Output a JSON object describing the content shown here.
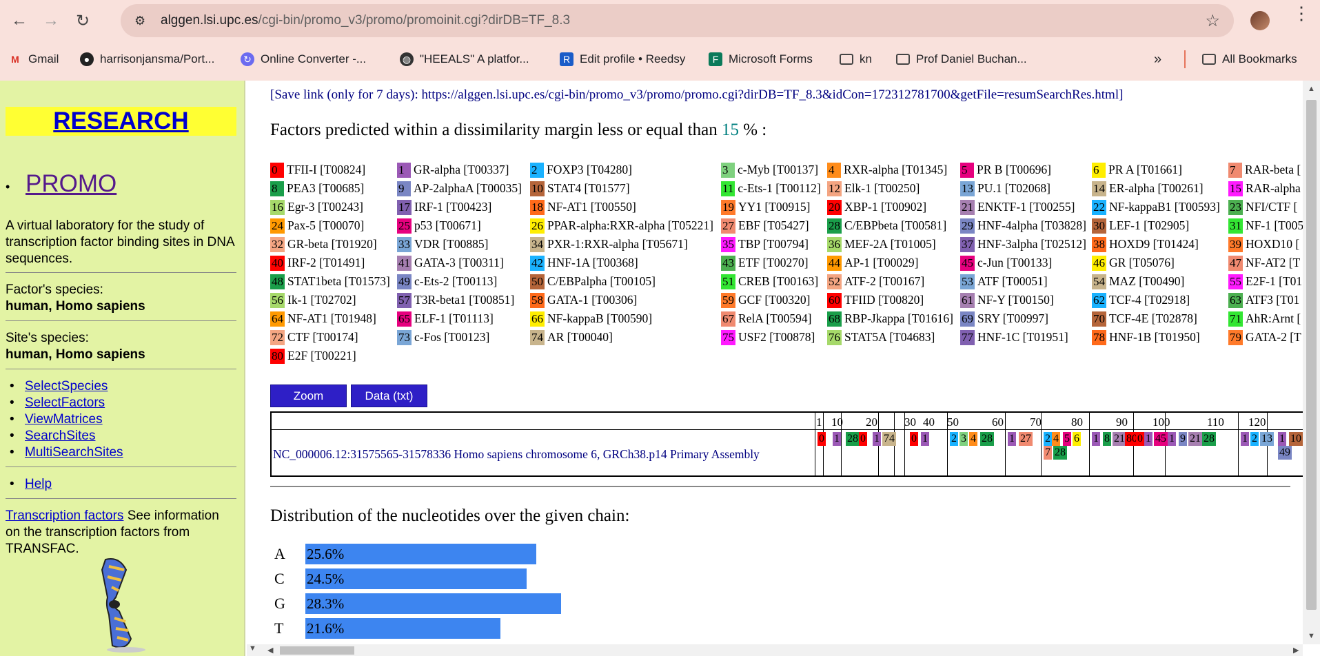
{
  "browser": {
    "url_host": "alggen.lsi.upc.es",
    "url_path": "/cgi-bin/promo_v3/promo/promoinit.cgi?dirDB=TF_8.3",
    "bookmarks": [
      "Gmail",
      "harrisonjansma/Port...",
      "Online Converter -...",
      "\"HEEALS\" A platfor...",
      "Edit profile • Reedsy",
      "Microsoft Forms",
      "kn",
      "Prof Daniel Buchan...",
      "All Bookmarks"
    ]
  },
  "sidebar": {
    "research": "RESEARCH",
    "promo": "PROMO",
    "description": "A virtual laboratory for the study of transcription factor binding sites in DNA sequences.",
    "factor_species_label": "Factor's species:",
    "factor_species": "human, Homo sapiens",
    "site_species_label": "Site's species:",
    "site_species": "human, Homo sapiens",
    "links": [
      "SelectSpecies",
      "SelectFactors",
      "ViewMatrices",
      "SearchSites",
      "MultiSearchSites"
    ],
    "help": "Help",
    "tf_link": "Transcription factors",
    "tf_text": " See information on the transcription factors from TRANSFAC."
  },
  "main": {
    "save_link": "[Save link (only for 7 days): https://alggen.lsi.upc.es/cgi-bin/promo_v3/promo/promo.cgi?dirDB=TF_8.3&idCon=172312781700&getFile=resumSearchRes.html]",
    "factors_title": "Factors predicted within a dissimilarity margin less or equal than ",
    "margin": "15",
    "margin_suffix": " % :",
    "zoom_label": "Zoom",
    "data_label": "Data (txt)",
    "sequence_name": "NC_000006.12:31575565-31578336 Homo sapiens chromosome 6, GRCh38.p14 Primary Assembly",
    "ticks": [
      "1",
      "10",
      "20",
      "30",
      "40",
      "50",
      "60",
      "70",
      "80",
      "90",
      "100",
      "110",
      "120"
    ],
    "dist_title": "Distribution of the nucleotides over the given chain:",
    "nucleotides": [
      {
        "base": "A",
        "label": "25.6%",
        "value": 25.6
      },
      {
        "base": "C",
        "label": "24.5%",
        "value": 24.5
      },
      {
        "base": "G",
        "label": "28.3%",
        "value": 28.3
      },
      {
        "base": "T",
        "label": "21.6%",
        "value": 21.6
      }
    ]
  },
  "factors": [
    [
      "0",
      "TFII-I [T00824]",
      "#ff0000"
    ],
    [
      "1",
      "GR-alpha [T00337]",
      "#9b59b6"
    ],
    [
      "2",
      "FOXP3 [T04280]",
      "#1ab2ff"
    ],
    [
      "3",
      "c-Myb [T00137]",
      "#7fd17f"
    ],
    [
      "4",
      "RXR-alpha [T01345]",
      "#ff8c1a"
    ],
    [
      "5",
      "PR B [T00696]",
      "#e6007e"
    ],
    [
      "6",
      "PR A [T01661]",
      "#ffee00"
    ],
    [
      "7",
      "RAR-beta [",
      "#f08a70"
    ],
    [
      "8",
      "PEA3 [T00685]",
      "#1a9e4a"
    ],
    [
      "9",
      "AP-2alphaA [T00035]",
      "#7a86c4"
    ],
    [
      "10",
      "STAT4 [T01577]",
      "#b5653a"
    ],
    [
      "11",
      "c-Ets-1 [T00112]",
      "#33e633"
    ],
    [
      "12",
      "Elk-1 [T00250]",
      "#f4a582"
    ],
    [
      "13",
      "PU.1 [T02068]",
      "#7aa6d6"
    ],
    [
      "14",
      "ER-alpha [T00261]",
      "#c8b48c"
    ],
    [
      "15",
      "RAR-alpha",
      "#ff1aff"
    ],
    [
      "16",
      "Egr-3 [T00243]",
      "#a6d96a"
    ],
    [
      "17",
      "IRF-1 [T00423]",
      "#8060b0"
    ],
    [
      "18",
      "NF-AT1 [T00550]",
      "#ff6a1a"
    ],
    [
      "19",
      "YY1 [T00915]",
      "#ff7a2a"
    ],
    [
      "20",
      "XBP-1 [T00902]",
      "#ff0000"
    ],
    [
      "21",
      "ENKTF-1 [T00255]",
      "#a67fb0"
    ],
    [
      "22",
      "NF-kappaB1 [T00593]",
      "#1ab2ff"
    ],
    [
      "23",
      "NFI/CTF [",
      "#4caf50"
    ],
    [
      "24",
      "Pax-5 [T00070]",
      "#ff9900"
    ],
    [
      "25",
      "p53 [T00671]",
      "#e6007e"
    ],
    [
      "26",
      "PPAR-alpha:RXR-alpha [T05221]",
      "#ffee00"
    ],
    [
      "27",
      "EBF [T05427]",
      "#f08a70"
    ],
    [
      "28",
      "C/EBPbeta [T00581]",
      "#1a9e4a"
    ],
    [
      "29",
      "HNF-4alpha [T03828]",
      "#7a86c4"
    ],
    [
      "30",
      "LEF-1 [T02905]",
      "#b5653a"
    ],
    [
      "31",
      "NF-1 [T005",
      "#33e633"
    ],
    [
      "32",
      "GR-beta [T01920]",
      "#f4a582"
    ],
    [
      "33",
      "VDR [T00885]",
      "#7aa6d6"
    ],
    [
      "34",
      "PXR-1:RXR-alpha [T05671]",
      "#c8b48c"
    ],
    [
      "35",
      "TBP [T00794]",
      "#ff1aff"
    ],
    [
      "36",
      "MEF-2A [T01005]",
      "#a6d96a"
    ],
    [
      "37",
      "HNF-3alpha [T02512]",
      "#8060b0"
    ],
    [
      "38",
      "HOXD9 [T01424]",
      "#ff6a1a"
    ],
    [
      "39",
      "HOXD10 [",
      "#ff7a2a"
    ],
    [
      "40",
      "IRF-2 [T01491]",
      "#ff0000"
    ],
    [
      "41",
      "GATA-3 [T00311]",
      "#a67fb0"
    ],
    [
      "42",
      "HNF-1A [T00368]",
      "#1ab2ff"
    ],
    [
      "43",
      "ETF [T00270]",
      "#4caf50"
    ],
    [
      "44",
      "AP-1 [T00029]",
      "#ff9900"
    ],
    [
      "45",
      "c-Jun [T00133]",
      "#e6007e"
    ],
    [
      "46",
      "GR [T05076]",
      "#ffee00"
    ],
    [
      "47",
      "NF-AT2 [T",
      "#f08a70"
    ],
    [
      "48",
      "STAT1beta [T01573]",
      "#1a9e4a"
    ],
    [
      "49",
      "c-Ets-2 [T00113]",
      "#7a86c4"
    ],
    [
      "50",
      "C/EBPalpha [T00105]",
      "#b5653a"
    ],
    [
      "51",
      "CREB [T00163]",
      "#33e633"
    ],
    [
      "52",
      "ATF-2 [T00167]",
      "#f4a582"
    ],
    [
      "53",
      "ATF [T00051]",
      "#7aa6d6"
    ],
    [
      "54",
      "MAZ [T00490]",
      "#c8b48c"
    ],
    [
      "55",
      "E2F-1 [T01",
      "#ff1aff"
    ],
    [
      "56",
      "Ik-1 [T02702]",
      "#a6d96a"
    ],
    [
      "57",
      "T3R-beta1 [T00851]",
      "#8060b0"
    ],
    [
      "58",
      "GATA-1 [T00306]",
      "#ff6a1a"
    ],
    [
      "59",
      "GCF [T00320]",
      "#ff7a2a"
    ],
    [
      "60",
      "TFIID [T00820]",
      "#ff0000"
    ],
    [
      "61",
      "NF-Y [T00150]",
      "#a67fb0"
    ],
    [
      "62",
      "TCF-4 [T02918]",
      "#1ab2ff"
    ],
    [
      "63",
      "ATF3 [T01",
      "#4caf50"
    ],
    [
      "64",
      "NF-AT1 [T01948]",
      "#ff9900"
    ],
    [
      "65",
      "ELF-1 [T01113]",
      "#e6007e"
    ],
    [
      "66",
      "NF-kappaB [T00590]",
      "#ffee00"
    ],
    [
      "67",
      "RelA [T00594]",
      "#f08a70"
    ],
    [
      "68",
      "RBP-Jkappa [T01616]",
      "#1a9e4a"
    ],
    [
      "69",
      "SRY [T00997]",
      "#7a86c4"
    ],
    [
      "70",
      "TCF-4E [T02878]",
      "#b5653a"
    ],
    [
      "71",
      "AhR:Arnt [",
      "#33e633"
    ],
    [
      "72",
      "CTF [T00174]",
      "#f4a582"
    ],
    [
      "73",
      "c-Fos [T00123]",
      "#7aa6d6"
    ],
    [
      "74",
      "AR [T00040]",
      "#c8b48c"
    ],
    [
      "75",
      "USF2 [T00878]",
      "#ff1aff"
    ],
    [
      "76",
      "STAT5A [T04683]",
      "#a6d96a"
    ],
    [
      "77",
      "HNF-1C [T01951]",
      "#8060b0"
    ],
    [
      "78",
      "HNF-1B [T01950]",
      "#ff6a1a"
    ],
    [
      "79",
      "GATA-2 [T",
      "#ff7a2a"
    ],
    [
      "80",
      "E2F [T00221]",
      "#ff0000"
    ]
  ],
  "sites": [
    [
      "0",
      "#ff0000"
    ],
    [
      "1",
      "#9b59b6"
    ],
    [
      "28",
      "#1a9e4a"
    ],
    [
      "0",
      "#ff0000"
    ],
    [
      "1",
      "#9b59b6"
    ],
    [
      "74",
      "#c8b48c"
    ],
    [
      "0",
      "#ff0000"
    ],
    [
      "1",
      "#9b59b6"
    ],
    [
      "2",
      "#1ab2ff"
    ],
    [
      "3",
      "#7fd17f"
    ],
    [
      "4",
      "#ff8c1a"
    ],
    [
      "28",
      "#1a9e4a"
    ],
    [
      "1",
      "#9b59b6"
    ],
    [
      "27",
      "#f08a70"
    ],
    [
      "2",
      "#1ab2ff"
    ],
    [
      "4",
      "#ff8c1a"
    ],
    [
      "5",
      "#e6007e"
    ],
    [
      "6",
      "#ffee00"
    ],
    [
      "7",
      "#f08a70"
    ],
    [
      "28",
      "#1a9e4a"
    ],
    [
      "1",
      "#9b59b6"
    ],
    [
      "8",
      "#1a9e4a"
    ],
    [
      "21",
      "#a67fb0"
    ],
    [
      "80",
      "#ff0000"
    ],
    [
      "0",
      "#ff0000"
    ],
    [
      "1",
      "#9b59b6"
    ],
    [
      "45",
      "#e6007e"
    ],
    [
      "1",
      "#9b59b6"
    ],
    [
      "9",
      "#7a86c4"
    ],
    [
      "21",
      "#a67fb0"
    ],
    [
      "28",
      "#1a9e4a"
    ],
    [
      "1",
      "#9b59b6"
    ],
    [
      "2",
      "#1ab2ff"
    ],
    [
      "13",
      "#7aa6d6"
    ],
    [
      "1",
      "#9b59b6"
    ],
    [
      "10",
      "#b5653a"
    ],
    [
      "49",
      "#7a86c4"
    ]
  ]
}
